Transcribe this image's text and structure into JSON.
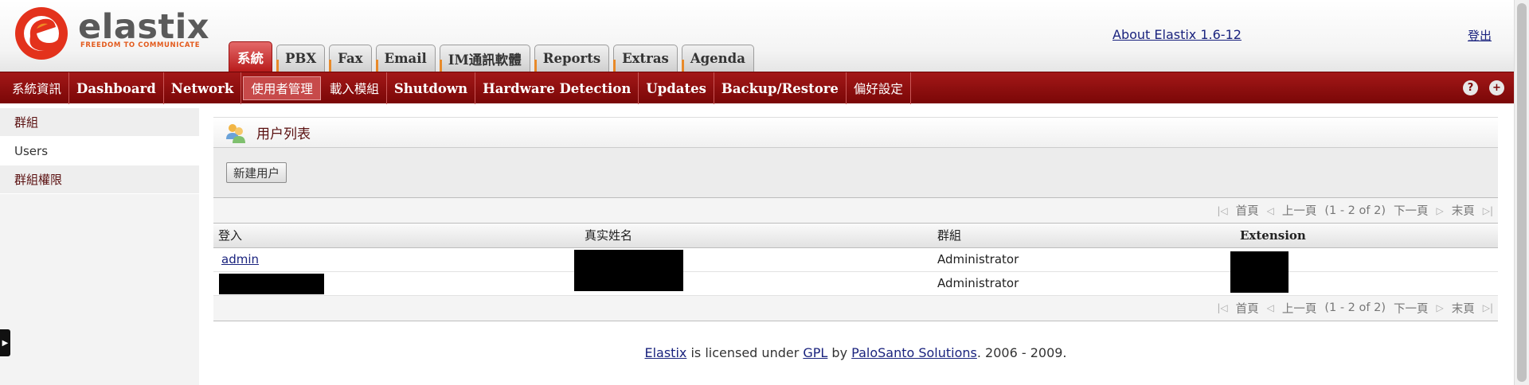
{
  "brand": {
    "logo_name": "elastix",
    "tagline": "FREEDOM TO COMMUNICATE",
    "colors": {
      "logo_red": "#e3321c",
      "logo_orange": "#f08a24",
      "menu_red": "#8e0f0f",
      "link": "#1a237e"
    }
  },
  "header": {
    "tabs": [
      {
        "label": "系統",
        "active": true
      },
      {
        "label": "PBX"
      },
      {
        "label": "Fax"
      },
      {
        "label": "Email"
      },
      {
        "label": "IM通訊軟體"
      },
      {
        "label": "Reports"
      },
      {
        "label": "Extras"
      },
      {
        "label": "Agenda"
      }
    ],
    "about_label": "About Elastix 1.6-12",
    "logout_label": "登出"
  },
  "menu": {
    "items": [
      {
        "label": "系統資訊"
      },
      {
        "label": "Dashboard"
      },
      {
        "label": "Network"
      },
      {
        "label": "使用者管理",
        "active": true
      },
      {
        "label": "載入模組"
      },
      {
        "label": "Shutdown"
      },
      {
        "label": "Hardware Detection"
      },
      {
        "label": "Updates"
      },
      {
        "label": "Backup/Restore"
      },
      {
        "label": "偏好設定"
      }
    ],
    "icons": [
      "help-icon",
      "add-icon"
    ],
    "help_glyph": "?",
    "add_glyph": "+"
  },
  "sidebar": {
    "items": [
      {
        "label": "群組"
      },
      {
        "label": "Users",
        "active": true
      },
      {
        "label": "群組權限"
      }
    ]
  },
  "main": {
    "title": "用户列表",
    "new_user_button": "新建用户",
    "pager": {
      "first": "首頁",
      "prev": "上一頁",
      "range": "(1 - 2 of 2)",
      "next": "下一頁",
      "last": "末頁"
    },
    "table": {
      "columns": [
        "登入",
        "真实姓名",
        "群組",
        "Extension"
      ],
      "rows": [
        {
          "login": "admin",
          "name": "",
          "group": "Administrator",
          "extension": ""
        },
        {
          "login": "",
          "name": "",
          "group": "Administrator",
          "extension": ""
        }
      ]
    }
  },
  "footer": {
    "elastix_link": "Elastix",
    "text1": " is licensed under ",
    "gpl_link": "GPL",
    "text2": " by ",
    "palosanto_link": "PaloSanto Solutions",
    "text3": ". 2006 - 2009."
  }
}
